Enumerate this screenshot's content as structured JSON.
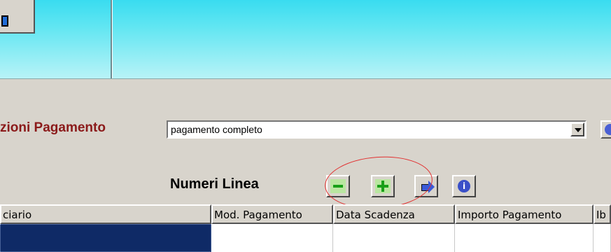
{
  "form": {
    "condizioni_label": "zioni Pagamento",
    "condizioni_value": "pagamento completo",
    "numeri_linea_label": "Numeri Linea"
  },
  "toolbar": {
    "info_symbol": "i"
  },
  "grid": {
    "columns": [
      "ciario",
      "Mod. Pagamento",
      "Data Scadenza",
      "Importo Pagamento",
      "Ib"
    ]
  },
  "colors": {
    "label_red": "#8b1a1a",
    "selected_row": "#0f2a66",
    "annotation_circle": "#e23030",
    "top_bar": "#39dcf0"
  },
  "icons": [
    "square-icon",
    "dropdown-arrow-icon",
    "info-icon",
    "minus-icon",
    "plus-icon",
    "arrow-right-icon"
  ]
}
